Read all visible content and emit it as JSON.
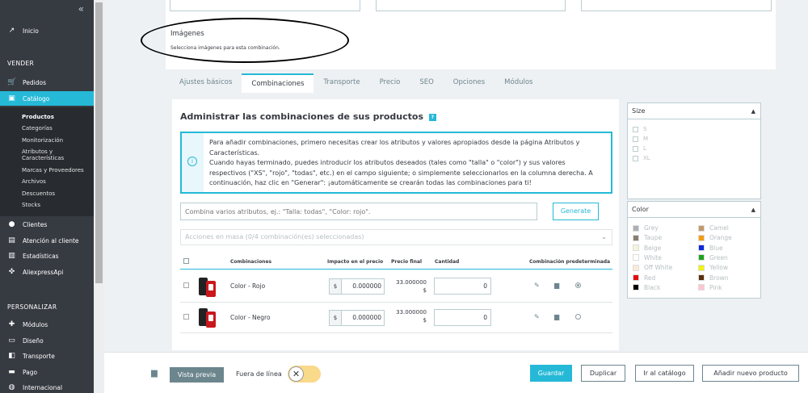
{
  "sidebar": {
    "collapse_icon": "«",
    "inicio": "Inicio",
    "section_vender": "VENDER",
    "pedidos": "Pedidos",
    "catalogo": "Catálogo",
    "sub": [
      "Productos",
      "Categorías",
      "Monitorización",
      "Atributos y",
      "Características",
      "Marcas y Proveedores",
      "Archivos",
      "Descuentos",
      "Stocks"
    ],
    "clientes": "Clientes",
    "atencion": "Atención al cliente",
    "estadisticas": "Estadísticas",
    "aliexpress": "AliexpressApi",
    "section_personalizar": "PERSONALIZAR",
    "modulos": "Módulos",
    "diseno": "Diseño",
    "transporte": "Transporte",
    "pago": "Pago",
    "internacional": "Internacional"
  },
  "images_section": {
    "title": "Imágenes",
    "subtitle": "Selecciona imágenes para esta combinación."
  },
  "tabs": [
    "Ajustes básicos",
    "Combinaciones",
    "Transporte",
    "Precio",
    "SEO",
    "Opciones",
    "Módulos"
  ],
  "combinations": {
    "heading": "Administrar las combinaciones de sus productos",
    "info_lines": [
      "Para añadir combinaciones, primero necesitas crear los atributos y valores apropiados desde la página Atributos y",
      "Características.",
      "Cuando hayas terminado, puedes introducir los atributos deseados (tales como \"talla\" o \"color\") y sus valores",
      "respectivos (\"XS\", \"rojo\", \"todas\", etc.) en el campo siguiente; o simplemente seleccionarlos en la columna derecha. A",
      "continuación, haz clic en \"Generar\": ¡automáticamente se crearán todas las combinaciones para ti!"
    ],
    "attr_placeholder": "Combina varios atributos, ej.: \"Talla: todas\", \"Color: rojo\".",
    "generate_label": "Generate",
    "bulk_label": "Acciones en masa (0/4 combinación(es) seleccionadas)",
    "columns": {
      "combinaciones": "Combinaciones",
      "impacto": "Impacto en el precio",
      "precio_final": "Precio final",
      "cantidad": "Cantidad",
      "predeterminada": "Combinación predeterminada"
    },
    "rows": [
      {
        "name": "Color - Rojo",
        "currency": "$",
        "impact": "0.000000",
        "final_price": "33.000000",
        "final_currency": "$",
        "quantity": "0",
        "default": true
      },
      {
        "name": "Color - Negro",
        "currency": "$",
        "impact": "0.000000",
        "final_price": "33.000000",
        "final_currency": "$",
        "quantity": "0",
        "default": false
      }
    ]
  },
  "size_panel": {
    "title": "Size",
    "options": [
      "S",
      "M",
      "L",
      "XL"
    ]
  },
  "color_panel": {
    "title": "Color",
    "options": [
      {
        "name": "Grey",
        "color": "#aab0b5"
      },
      {
        "name": "Camel",
        "color": "#c19a6b"
      },
      {
        "name": "Taupe",
        "color": "#8b7e70"
      },
      {
        "name": "Orange",
        "color": "#f39c11"
      },
      {
        "name": "Beige",
        "color": "#f5f5dc"
      },
      {
        "name": "Blue",
        "color": "#0b29dd"
      },
      {
        "name": "White",
        "color": "#ffffff"
      },
      {
        "name": "Green",
        "color": "#1ca21c"
      },
      {
        "name": "Off White",
        "color": "#faebd7"
      },
      {
        "name": "Yellow",
        "color": "#f1f30f"
      },
      {
        "name": "Red",
        "color": "#e30c0c"
      },
      {
        "name": "Brown",
        "color": "#5d2f0c"
      },
      {
        "name": "Black",
        "color": "#000000"
      },
      {
        "name": "Pink",
        "color": "#fcc5d0"
      }
    ]
  },
  "footer": {
    "vista_previa": "Vista previa",
    "fuera_de_linea": "Fuera de línea",
    "toggle_icon": "✕",
    "guardar": "Guardar",
    "duplicar": "Duplicar",
    "ir_catalogo": "Ir al catálogo",
    "anadir": "Añadir nuevo producto"
  },
  "colors": {
    "accent": "#25b9d7",
    "sidebar_bg": "#363a41"
  }
}
